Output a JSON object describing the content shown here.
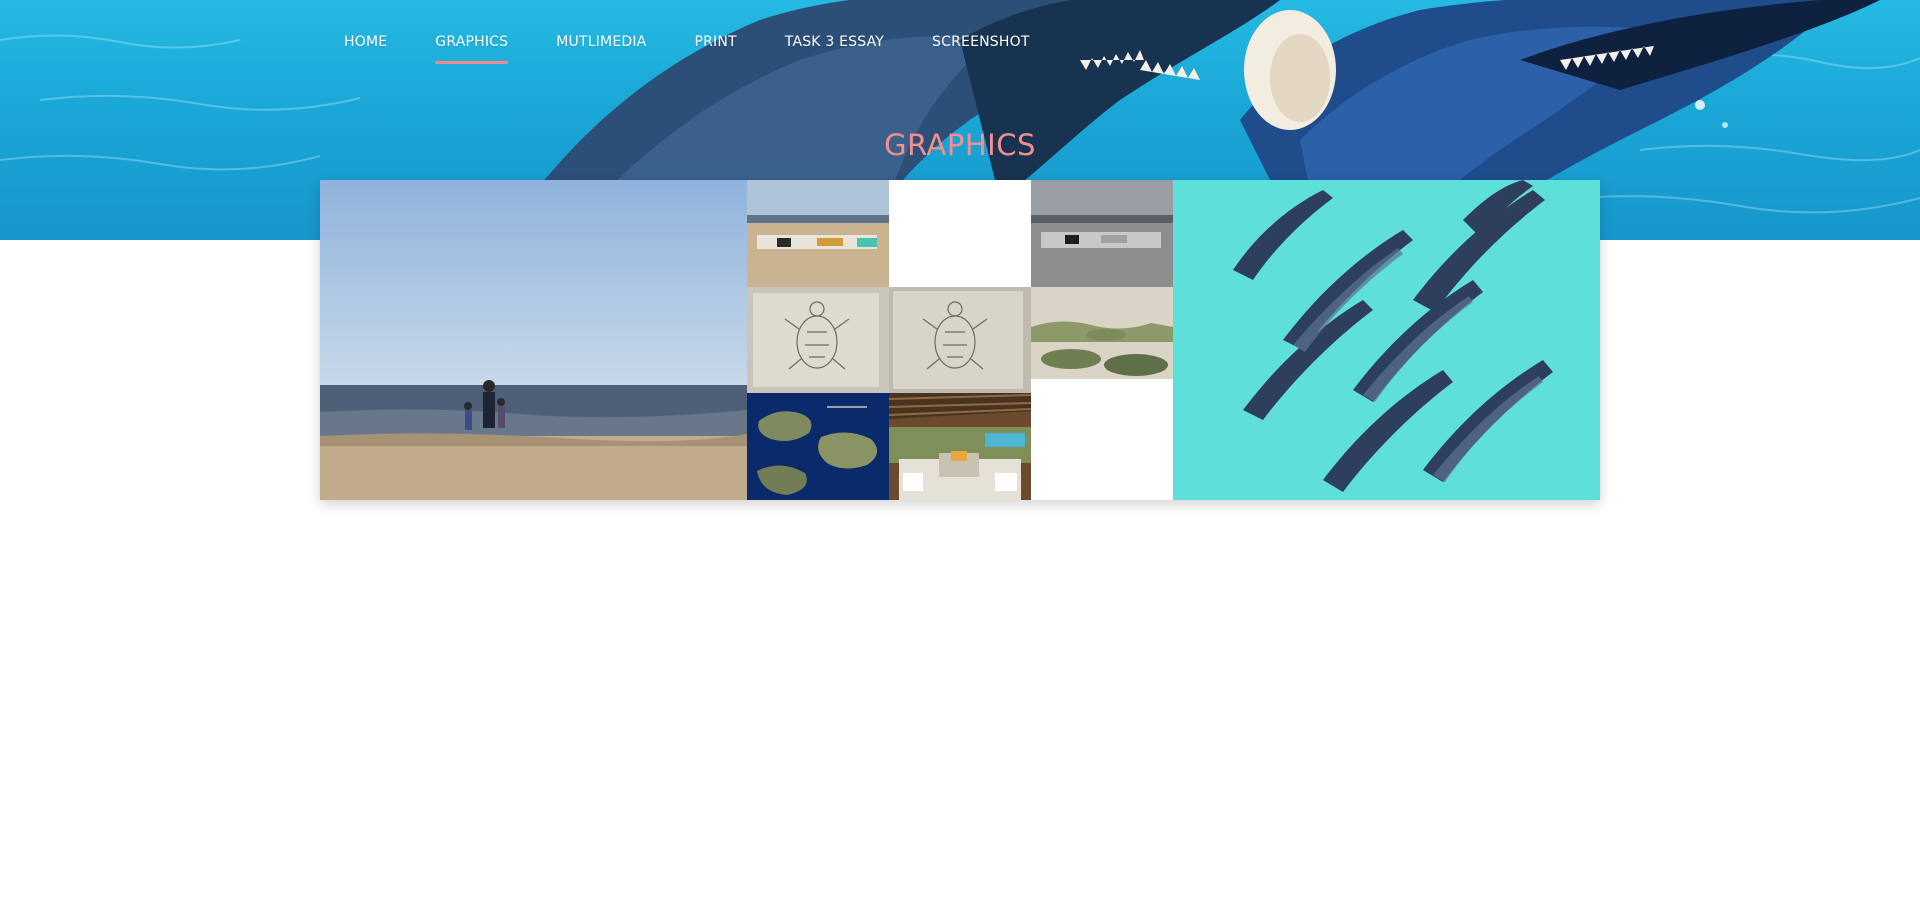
{
  "nav": {
    "items": [
      {
        "label": "HOME",
        "active": false
      },
      {
        "label": "GRAPHICS",
        "active": true
      },
      {
        "label": "MUTLIMEDIA",
        "active": false
      },
      {
        "label": "PRINT",
        "active": false
      },
      {
        "label": "TASK 3 ESSAY",
        "active": false
      },
      {
        "label": "SCREENSHOT",
        "active": false
      }
    ]
  },
  "page": {
    "title": "GRAPHICS"
  },
  "colors": {
    "accent": "#f58f8f",
    "hero_water": "#1aa7d6",
    "dolphin_backdrop": "#5fdfd9",
    "deep_blue": "#0b2a6b"
  },
  "gallery": {
    "images": [
      {
        "subject": "beach-family-photo"
      },
      {
        "subject": "beach-towels-photo"
      },
      {
        "subject": "turtle-sketch-photo"
      },
      {
        "subject": "turtle-sketch-photo"
      },
      {
        "subject": "beach-towels-gray-photo"
      },
      {
        "subject": "rocky-shore-photo"
      },
      {
        "subject": "island-map-illustration"
      },
      {
        "subject": "resort-patio-photo"
      },
      {
        "subject": "dolphin-pod-illustration"
      }
    ]
  }
}
